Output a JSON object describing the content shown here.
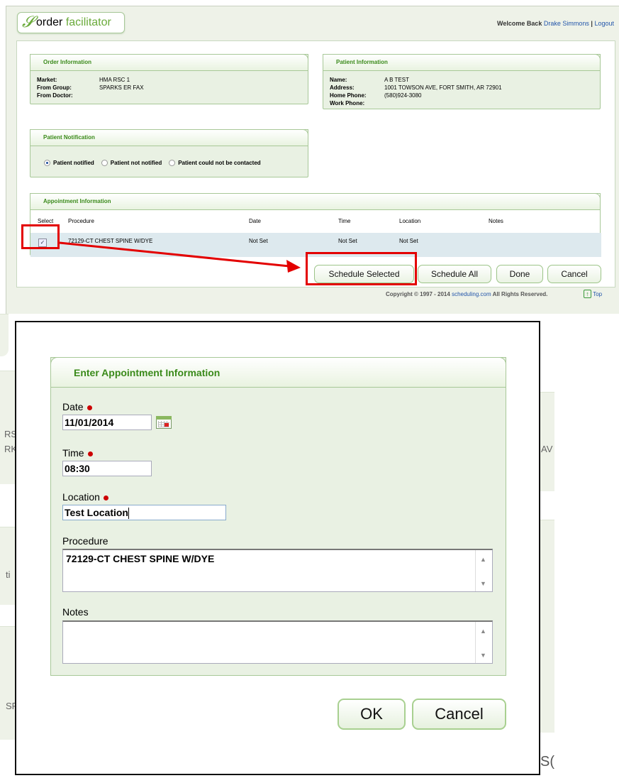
{
  "header": {
    "logo_text_1": "order",
    "logo_text_2": "facilitator",
    "welcome_prefix": "Welcome Back",
    "user_name": "Drake Simmons",
    "separator": "|",
    "logout": "Logout"
  },
  "order_info": {
    "title": "Order Information",
    "rows": [
      {
        "key": "Market:",
        "value": "HMA RSC 1"
      },
      {
        "key": "From Group:",
        "value": "SPARKS ER FAX"
      },
      {
        "key": "From Doctor:",
        "value": ""
      }
    ]
  },
  "patient_info": {
    "title": "Patient Information",
    "rows": [
      {
        "key": "Name:",
        "value": "A B TEST"
      },
      {
        "key": "Address:",
        "value": "1001 TOWSON AVE, FORT SMITH, AR 72901"
      },
      {
        "key": "Home Phone:",
        "value": "(580)924-3080"
      },
      {
        "key": "Work Phone:",
        "value": ""
      }
    ]
  },
  "notification": {
    "title": "Patient Notification",
    "options": [
      "Patient notified",
      "Patient not notified",
      "Patient could not be contacted"
    ],
    "selected": 0
  },
  "appointments": {
    "title": "Appointment Information",
    "columns": [
      "Select",
      "Procedure",
      "Date",
      "Time",
      "Location",
      "Notes"
    ],
    "rows": [
      {
        "checked": true,
        "procedure": "72129-CT CHEST SPINE W/DYE",
        "date": "Not Set",
        "time": "Not Set",
        "location": "Not Set",
        "notes": ""
      }
    ],
    "checkmark": "✓"
  },
  "actions": {
    "schedule_selected": "Schedule Selected",
    "schedule_all": "Schedule All",
    "done": "Done",
    "cancel": "Cancel"
  },
  "footer": {
    "copyright_prefix": "Copyright © 1997 - 2014",
    "link": "scheduling.com",
    "suffix": "All Rights Reserved.",
    "top": "Top",
    "top_icon": "↑"
  },
  "dialog": {
    "title": "Enter Appointment Information",
    "date_label": "Date",
    "date_value": "11/01/2014",
    "time_label": "Time",
    "time_value": "08:30",
    "location_label": "Location",
    "location_value": "Test Location",
    "procedure_label": "Procedure",
    "procedure_value": "72129-CT CHEST SPINE W/DYE",
    "notes_label": "Notes",
    "notes_value": "",
    "ok": "OK",
    "cancel": "Cancel",
    "scroll_up": "▲",
    "scroll_down": "▼"
  },
  "background_fragments": [
    "RS",
    "RK",
    "AV",
    "ti",
    "SF",
    "S("
  ],
  "colors": {
    "accent_green": "#3a8a1a",
    "highlight_red": "#e30000",
    "link_blue": "#2255aa"
  }
}
